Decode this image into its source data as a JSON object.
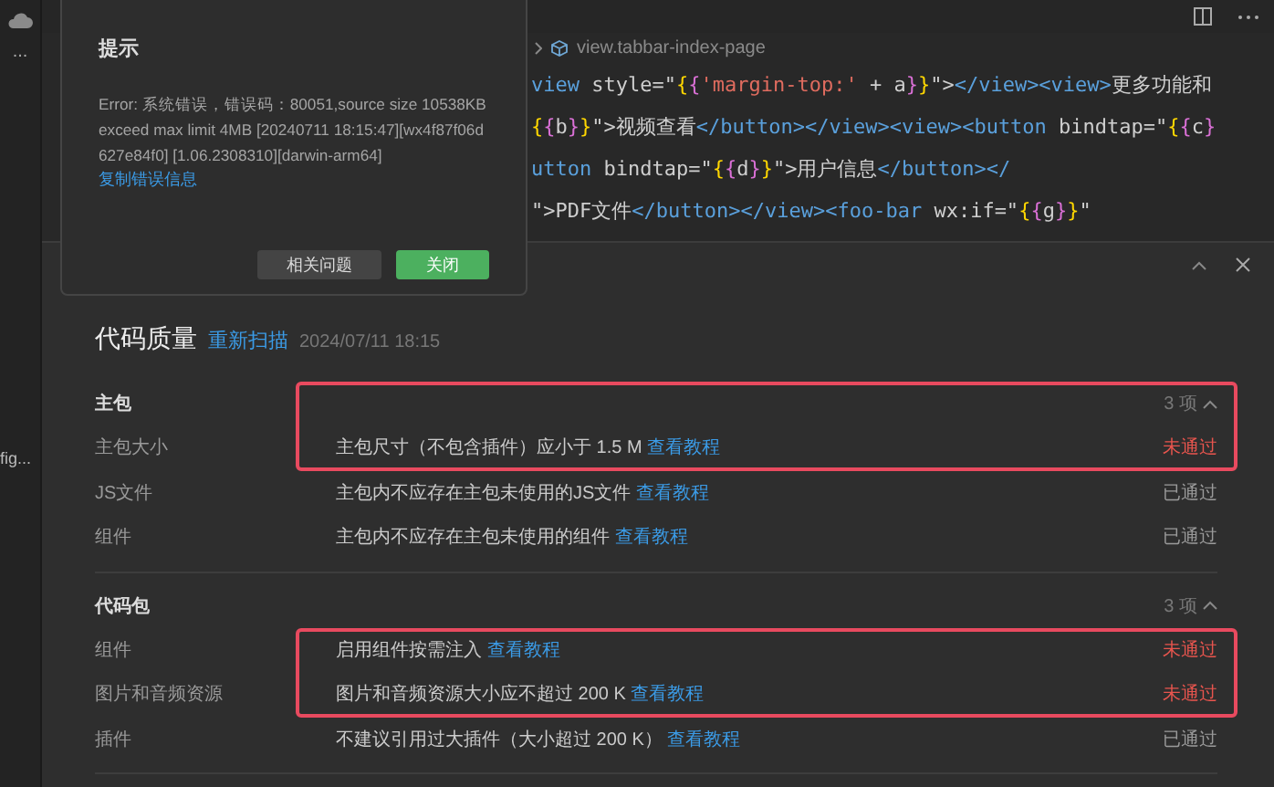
{
  "activity_bar": {
    "more": "...",
    "file_item": "fig..."
  },
  "editor": {
    "breadcrumb": "view.tabbar-index-page",
    "code_lines": [
      {
        "tokens": [
          {
            "text": "view",
            "kind": "tag"
          },
          {
            "text": " style=\"",
            "kind": "plain"
          },
          {
            "text": "{",
            "kind": "brace"
          },
          {
            "text": "{",
            "kind": "brace2"
          },
          {
            "text": "'margin-top:'",
            "kind": "string"
          },
          {
            "text": " + a",
            "kind": "plain"
          },
          {
            "text": "}",
            "kind": "brace2"
          },
          {
            "text": "}",
            "kind": "brace"
          },
          {
            "text": "\">",
            "kind": "plain"
          },
          {
            "text": "</view><view>",
            "kind": "tag"
          },
          {
            "text": "更多功能和",
            "kind": "plain"
          }
        ]
      },
      {
        "tokens": [
          {
            "text": "{",
            "kind": "brace"
          },
          {
            "text": "{",
            "kind": "brace2"
          },
          {
            "text": "b",
            "kind": "plain"
          },
          {
            "text": "}",
            "kind": "brace2"
          },
          {
            "text": "}",
            "kind": "brace"
          },
          {
            "text": "\">视频查看",
            "kind": "plain"
          },
          {
            "text": "</button></view><view><button",
            "kind": "tag"
          },
          {
            "text": " bindtap=\"",
            "kind": "plain"
          },
          {
            "text": "{",
            "kind": "brace"
          },
          {
            "text": "{",
            "kind": "brace2"
          },
          {
            "text": "c",
            "kind": "plain"
          },
          {
            "text": "}",
            "kind": "brace2"
          }
        ]
      },
      {
        "tokens": [
          {
            "text": "utton",
            "kind": "tag"
          },
          {
            "text": " bindtap=\"",
            "kind": "plain"
          },
          {
            "text": "{",
            "kind": "brace"
          },
          {
            "text": "{",
            "kind": "brace2"
          },
          {
            "text": "d",
            "kind": "plain"
          },
          {
            "text": "}",
            "kind": "brace2"
          },
          {
            "text": "}",
            "kind": "brace"
          },
          {
            "text": "\">用户信息",
            "kind": "plain"
          },
          {
            "text": "</button></",
            "kind": "tag"
          }
        ]
      },
      {
        "tokens": [
          {
            "text": "\">PDF文件",
            "kind": "plain"
          },
          {
            "text": "</button></view><foo-bar",
            "kind": "tag"
          },
          {
            "text": " wx:if=\"",
            "kind": "plain"
          },
          {
            "text": "{",
            "kind": "brace"
          },
          {
            "text": "{",
            "kind": "brace2"
          },
          {
            "text": "g",
            "kind": "plain"
          },
          {
            "text": "}",
            "kind": "brace2"
          },
          {
            "text": "}",
            "kind": "brace"
          },
          {
            "text": "\"",
            "kind": "plain"
          }
        ]
      }
    ]
  },
  "dialog": {
    "title": "提示",
    "message": "Error: 系统错误，错误码：80051,source size 10538KB exceed max limit 4MB [20240711 18:15:47][wx4f87f06d627e84f0] [1.06.2308310][darwin-arm64]",
    "copy_link": "复制错误信息",
    "buttons": [
      {
        "label": "相关问题",
        "kind": "secondary"
      },
      {
        "label": "关闭",
        "kind": "primary"
      }
    ]
  },
  "panel": {
    "title": "代码质量",
    "rescan": "重新扫描",
    "timestamp": "2024/07/11 18:15",
    "sections": [
      {
        "name": "主包",
        "count": "3 项",
        "expanded": true,
        "highlighted": true,
        "rows": [
          {
            "label": "主包大小",
            "description": "主包尺寸（不包含插件）应小于 1.5 M",
            "link": "查看教程",
            "status": "未通过",
            "passed": false,
            "highlighted": true
          },
          {
            "label": "JS文件",
            "description": "主包内不应存在主包未使用的JS文件",
            "link": "查看教程",
            "status": "已通过",
            "passed": true,
            "highlighted": false
          },
          {
            "label": "组件",
            "description": "主包内不应存在主包未使用的组件",
            "link": "查看教程",
            "status": "已通过",
            "passed": true,
            "highlighted": false
          }
        ]
      },
      {
        "name": "代码包",
        "count": "3 项",
        "expanded": true,
        "highlighted": false,
        "rows": [
          {
            "label": "组件",
            "description": "启用组件按需注入",
            "link": "查看教程",
            "status": "未通过",
            "passed": false,
            "highlighted": true
          },
          {
            "label": "图片和音频资源",
            "description": "图片和音频资源大小应不超过 200 K",
            "link": "查看教程",
            "status": "未通过",
            "passed": false,
            "highlighted": true
          },
          {
            "label": "插件",
            "description": "不建议引用过大插件（大小超过 200 K）",
            "link": "查看教程",
            "status": "已通过",
            "passed": true,
            "highlighted": false
          }
        ]
      }
    ]
  }
}
